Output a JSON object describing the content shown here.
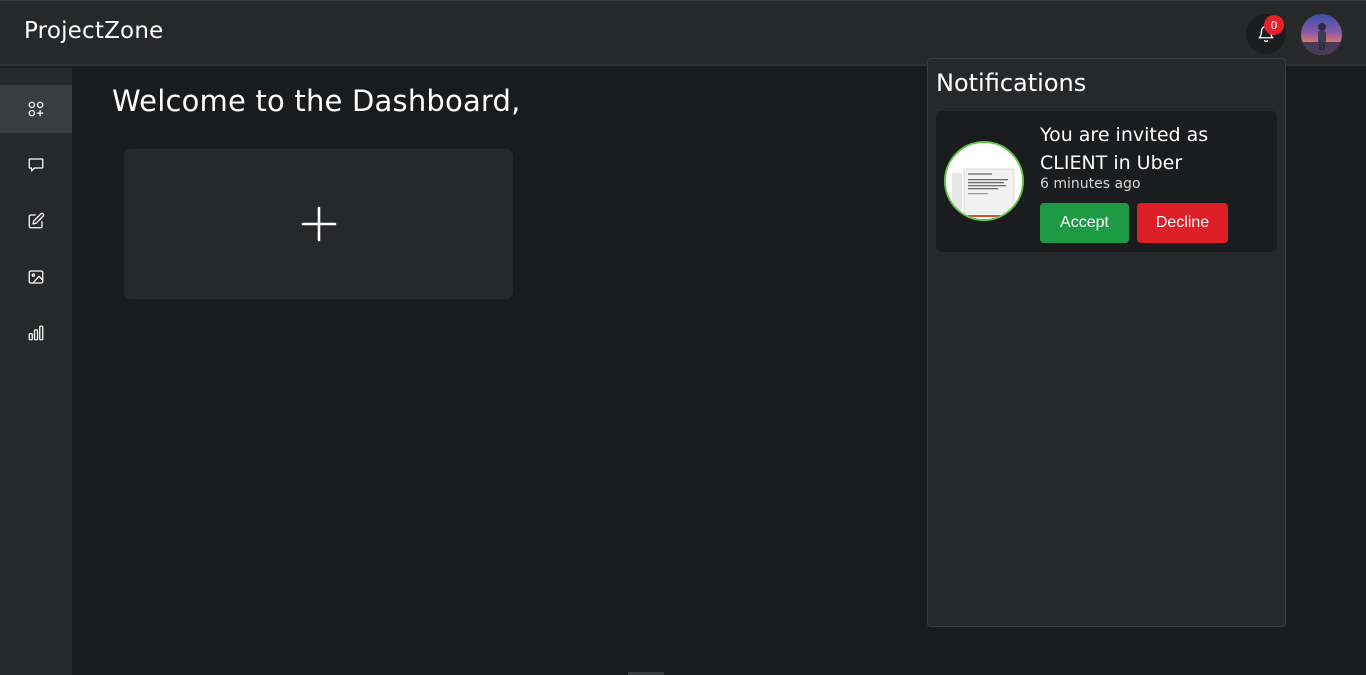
{
  "header": {
    "brand": "ProjectZone",
    "notification_count": "0",
    "icons": {
      "bell": "bell-icon",
      "avatar": "user-avatar"
    }
  },
  "sidebar": {
    "items": [
      {
        "name": "dashboard",
        "icon": "grid-add-icon",
        "active": true
      },
      {
        "name": "messages",
        "icon": "chat-bubble-icon",
        "active": false
      },
      {
        "name": "edit",
        "icon": "edit-icon",
        "active": false
      },
      {
        "name": "gallery",
        "icon": "image-icon",
        "active": false
      },
      {
        "name": "analytics",
        "icon": "bar-chart-icon",
        "active": false
      }
    ]
  },
  "main": {
    "welcome": "Welcome to the Dashboard,",
    "add_card_icon": "plus-icon"
  },
  "notifications": {
    "title": "Notifications",
    "items": [
      {
        "message": "You are invited as CLIENT in Uber",
        "time": "6 minutes ago",
        "accept_label": "Accept",
        "decline_label": "Decline"
      }
    ]
  },
  "colors": {
    "background": "#1a1b1d",
    "panel": "#27282a",
    "accept": "#1d9b44",
    "decline": "#de1f27",
    "badge": "#e8202a",
    "thumb_border": "#62c545"
  }
}
